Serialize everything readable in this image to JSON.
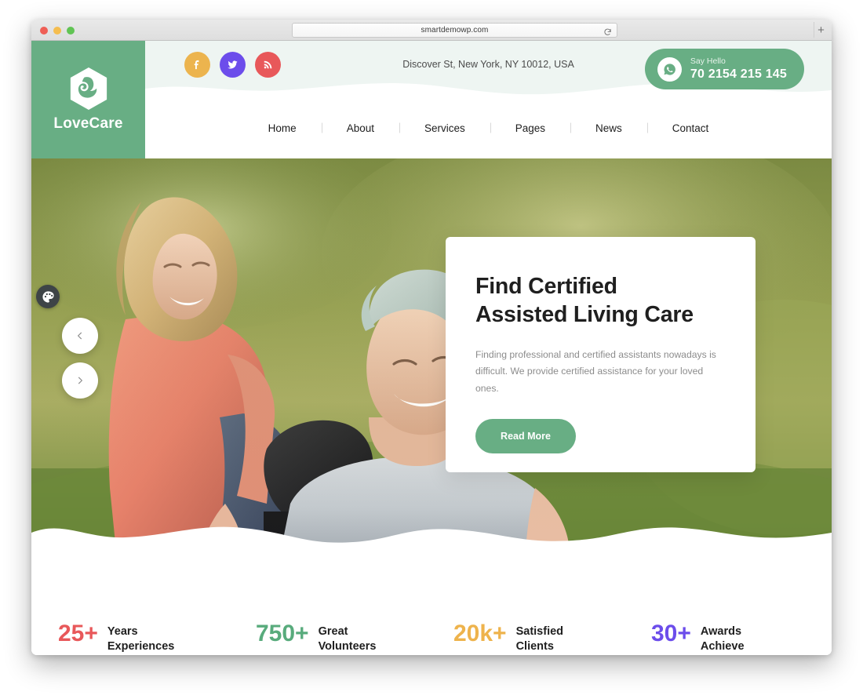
{
  "browser": {
    "url": "smartdemowp.com",
    "reload_icon": "reload-icon",
    "newtab_label": "+",
    "traffic_lights": [
      "close",
      "minimize",
      "zoom"
    ]
  },
  "site": {
    "logo": {
      "text": "LoveCare",
      "icon": "lovecare-logo-icon"
    },
    "topbar": {
      "socials": [
        {
          "name": "facebook",
          "icon": "facebook-icon",
          "color": "#ecb44e"
        },
        {
          "name": "twitter",
          "icon": "twitter-icon",
          "color": "#6c4deb"
        },
        {
          "name": "rss",
          "icon": "rss-icon",
          "color": "#e8585a"
        }
      ],
      "address": "Discover St, New York, NY 10012, USA",
      "call": {
        "icon": "whatsapp-phone-icon",
        "label": "Say Hello",
        "number": "70 2154 215 145"
      }
    },
    "nav": [
      {
        "label": "Home"
      },
      {
        "label": "About"
      },
      {
        "label": "Services"
      },
      {
        "label": "Pages"
      },
      {
        "label": "News"
      },
      {
        "label": "Contact"
      }
    ],
    "hero": {
      "palette_icon": "palette-icon",
      "prev_icon": "chevron-left-icon",
      "next_icon": "chevron-right-icon",
      "title_line1": "Find Certified",
      "title_line2": "Assisted Living Care",
      "description": "Finding professional and certified assistants nowadays is difficult. We provide certified assistance for your loved ones.",
      "button_label": "Read More"
    },
    "stats": [
      {
        "number": "25+",
        "label_line1": "Years",
        "label_line2": "Experiences",
        "color": "#e8585a"
      },
      {
        "number": "750+",
        "label_line1": "Great",
        "label_line2": "Volunteers",
        "color": "#58ab7c"
      },
      {
        "number": "20k+",
        "label_line1": "Satisfied",
        "label_line2": "Clients",
        "color": "#eeb34c"
      },
      {
        "number": "30+",
        "label_line1": "Awards",
        "label_line2": "Achieve",
        "color": "#6c4deb"
      }
    ]
  },
  "theme": {
    "brand_green": "#68ae84",
    "topbar_bg": "#eef5f2",
    "text_dark": "#1f1f1f",
    "text_muted": "#8c8c8c"
  }
}
